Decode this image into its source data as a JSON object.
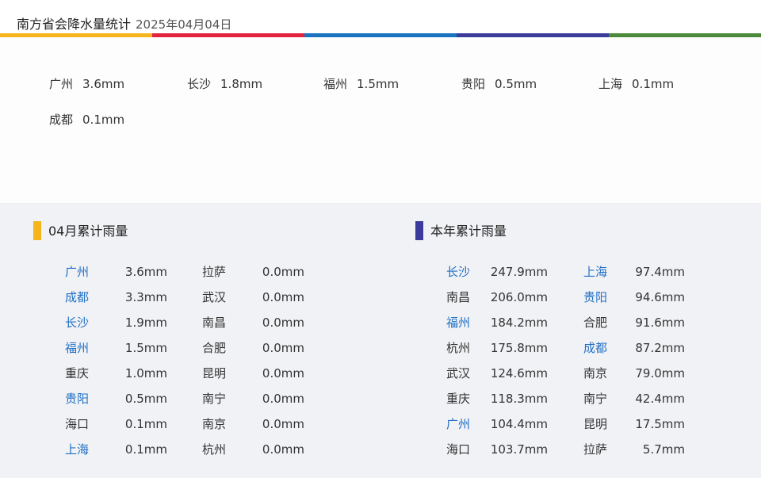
{
  "header": {
    "title": "南方省会降水量统计",
    "date": "2025年04月04日",
    "bar_colors": [
      "#f6b51c",
      "#e3223f",
      "#1a73c0",
      "#3b3b9b",
      "#4a8a3a"
    ]
  },
  "today": {
    "items": [
      {
        "city": "广州",
        "value": "3.6mm"
      },
      {
        "city": "长沙",
        "value": "1.8mm"
      },
      {
        "city": "福州",
        "value": "1.5mm"
      },
      {
        "city": "贵阳",
        "value": "0.5mm"
      },
      {
        "city": "上海",
        "value": "0.1mm"
      },
      {
        "city": "成都",
        "value": "0.1mm"
      }
    ]
  },
  "monthly": {
    "title": "04月累计雨量",
    "marker_color": "#f6b51c",
    "left": [
      {
        "city": "广州",
        "value": "3.6mm"
      },
      {
        "city": "成都",
        "value": "3.3mm"
      },
      {
        "city": "长沙",
        "value": "1.9mm"
      },
      {
        "city": "福州",
        "value": "1.5mm"
      },
      {
        "city": "重庆",
        "value": "1.0mm"
      },
      {
        "city": "贵阳",
        "value": "0.5mm"
      },
      {
        "city": "海口",
        "value": "0.1mm"
      },
      {
        "city": "上海",
        "value": "0.1mm"
      }
    ],
    "right": [
      {
        "city": "拉萨",
        "value": "0.0mm"
      },
      {
        "city": "武汉",
        "value": "0.0mm"
      },
      {
        "city": "南昌",
        "value": "0.0mm"
      },
      {
        "city": "合肥",
        "value": "0.0mm"
      },
      {
        "city": "昆明",
        "value": "0.0mm"
      },
      {
        "city": "南宁",
        "value": "0.0mm"
      },
      {
        "city": "南京",
        "value": "0.0mm"
      },
      {
        "city": "杭州",
        "value": "0.0mm"
      }
    ]
  },
  "yearly": {
    "title": "本年累计雨量",
    "marker_color": "#3b3b9b",
    "left": [
      {
        "city": "长沙",
        "value": "247.9mm"
      },
      {
        "city": "南昌",
        "value": "206.0mm"
      },
      {
        "city": "福州",
        "value": "184.2mm"
      },
      {
        "city": "杭州",
        "value": "175.8mm"
      },
      {
        "city": "武汉",
        "value": "124.6mm"
      },
      {
        "city": "重庆",
        "value": "118.3mm"
      },
      {
        "city": "广州",
        "value": "104.4mm"
      },
      {
        "city": "海口",
        "value": "103.7mm"
      }
    ],
    "right": [
      {
        "city": "上海",
        "value": "97.4mm"
      },
      {
        "city": "贵阳",
        "value": "94.6mm"
      },
      {
        "city": "合肥",
        "value": "91.6mm"
      },
      {
        "city": "成都",
        "value": "87.2mm"
      },
      {
        "city": "南京",
        "value": "79.0mm"
      },
      {
        "city": "南宁",
        "value": "42.4mm"
      },
      {
        "city": "昆明",
        "value": "17.5mm"
      },
      {
        "city": "拉萨",
        "value": "5.7mm"
      }
    ]
  },
  "highlight_color": "#1f6fc6",
  "highlight_cities": [
    "广州",
    "成都",
    "长沙",
    "福州",
    "贵阳",
    "上海"
  ]
}
